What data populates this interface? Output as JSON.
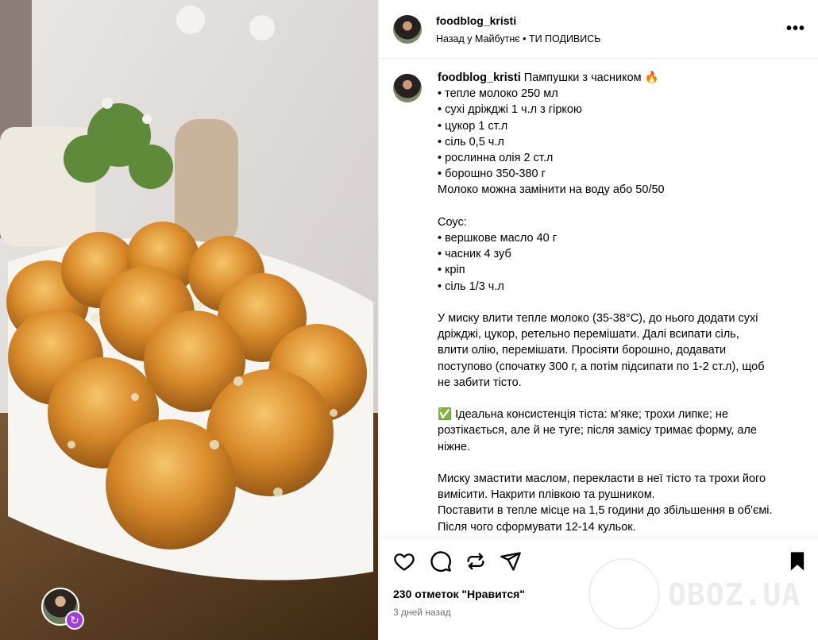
{
  "post": {
    "username": "foodblog_kristi",
    "audio_line": "Назад у Майбутнє • ТИ ПОДИВИСЬ",
    "more_icon": "more-horizontal-icon",
    "caption_lines": [
      "Пампушки з часником 🔥",
      "• тепле молоко 250 мл",
      "• сухі дріжджі 1 ч.л з гіркою",
      "• цукор 1 ст.л",
      "• сіль 0,5 ч.л",
      "• рослинна олія 2 ст.л",
      "• борошно 350-380 г",
      "Молоко можна замінити на воду або 50/50",
      "",
      "Соус:",
      "• вершкове масло 40 г",
      "• часник 4 зуб",
      "• кріп",
      "• сіль 1/3 ч.л",
      "",
      "У миску влити тепле молоко (35-38°С), до нього додати сухі",
      "дріжджі, цукор, ретельно перемішати. Далі всипати сіль,",
      "влити олію, перемішати. Просіяти борошно, додавати",
      "поступово (спочатку 300 г, а потім підсипати по 1-2 ст.л), щоб",
      "не забити тісто.",
      "",
      "✅ Ідеальна консистенція тіста: м'яке; трохи липке; не",
      "розтікається, але й не туге; після замісу тримає форму, але",
      "ніжне.",
      "",
      "Миску змастити маслом, перекласти в неї тісто та трохи його",
      "вимісити. Накрити плівкою та рушником.",
      "Поставити в тепле місце на 1,5 години до збільшення в об'ємі.",
      "Після чого сформувати 12-14 кульок."
    ],
    "likes": "230 отметок \"Нравится\"",
    "date": "3 дней назад",
    "watermark": "OBOZ.UA",
    "icons": [
      "heart-icon",
      "comment-icon",
      "share-icon",
      "send-icon",
      "bookmark-icon"
    ]
  }
}
